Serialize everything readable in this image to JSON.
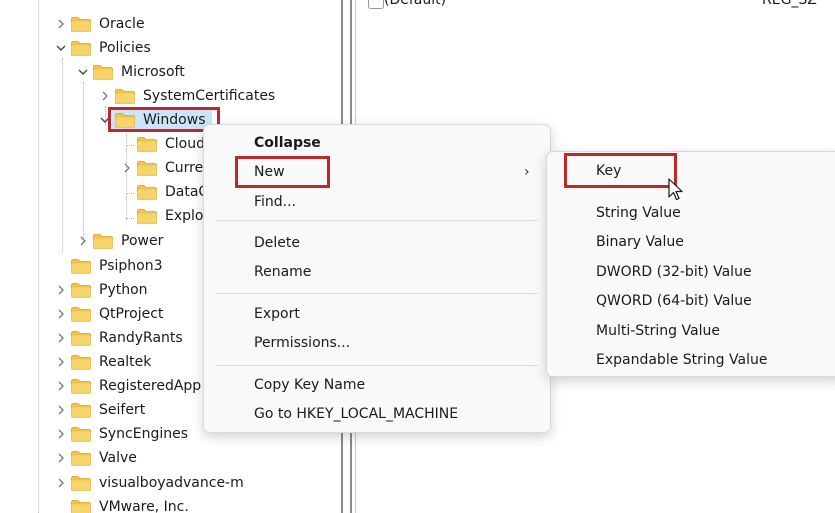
{
  "tree": {
    "items": [
      {
        "label": "Oracle",
        "expanded": false
      },
      {
        "label": "Policies",
        "expanded": true
      },
      {
        "label": "Microsoft",
        "expanded": true
      },
      {
        "label": "SystemCertificates",
        "expanded": false
      },
      {
        "label": "Windows",
        "expanded": true,
        "selected": true
      },
      {
        "label": "Cloud",
        "expanded": false
      },
      {
        "label": "Curre",
        "expanded": false
      },
      {
        "label": "DataC",
        "expanded": false
      },
      {
        "label": "Explo",
        "expanded": false
      },
      {
        "label": "Power",
        "expanded": false
      },
      {
        "label": "Psiphon3",
        "expanded": false
      },
      {
        "label": "Python",
        "expanded": false
      },
      {
        "label": "QtProject",
        "expanded": false
      },
      {
        "label": "RandyRants",
        "expanded": false
      },
      {
        "label": "Realtek",
        "expanded": false
      },
      {
        "label": "RegisteredApp",
        "expanded": false
      },
      {
        "label": "Seifert",
        "expanded": false
      },
      {
        "label": "SyncEngines",
        "expanded": false
      },
      {
        "label": "Valve",
        "expanded": false
      },
      {
        "label": "visualboyadvance-m",
        "expanded": false
      },
      {
        "label": "VMware, Inc.",
        "expanded": false
      }
    ]
  },
  "values": {
    "default_name": "(Default)",
    "default_type": "REG_SZ"
  },
  "context_menu": {
    "collapse": "Collapse",
    "new": "New",
    "new_arrow": "›",
    "find": "Find...",
    "delete": "Delete",
    "rename": "Rename",
    "export": "Export",
    "permissions": "Permissions...",
    "copy_key_name": "Copy Key Name",
    "goto": "Go to HKEY_LOCAL_MACHINE"
  },
  "submenu": {
    "key": "Key",
    "string_value": "String Value",
    "binary_value": "Binary Value",
    "dword_value": "DWORD (32-bit) Value",
    "qword_value": "QWORD (64-bit) Value",
    "multi_string_value": "Multi-String Value",
    "expandable_string_value": "Expandable String Value"
  },
  "colors": {
    "highlight_border": "#c0272d",
    "selection_bg": "#cce4f7",
    "folder": "#f2c34a"
  },
  "icons": {
    "folder": "folder-icon",
    "chevron_right": "chevron-right-icon",
    "chevron_down": "chevron-down-icon",
    "submenu_arrow": "chevron-right-icon",
    "cursor": "mouse-pointer-icon"
  }
}
